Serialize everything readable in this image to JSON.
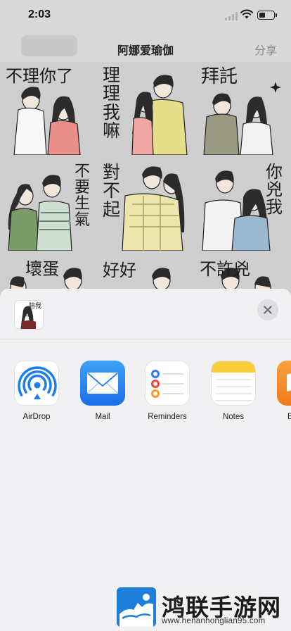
{
  "status_bar": {
    "time": "2:03"
  },
  "nav": {
    "title": "阿娜爱瑜伽",
    "share_label": "分享"
  },
  "stickers": [
    {
      "caption": "不理你了"
    },
    {
      "caption": "理理我嘛"
    },
    {
      "caption": "拜託"
    },
    {
      "caption": "不要生氣"
    },
    {
      "caption": "對不起"
    },
    {
      "caption": "你兇我"
    },
    {
      "caption": "壞蛋"
    },
    {
      "caption": "好好"
    },
    {
      "caption": "不許兇"
    }
  ],
  "sheet": {
    "thumbnail_caption": "陪我",
    "apps": [
      {
        "label": "AirDrop",
        "icon": "airdrop-icon"
      },
      {
        "label": "Mail",
        "icon": "mail-icon"
      },
      {
        "label": "Reminders",
        "icon": "reminders-icon"
      },
      {
        "label": "Notes",
        "icon": "notes-icon"
      },
      {
        "label": "B",
        "icon": "books-icon"
      }
    ]
  },
  "watermark": {
    "brand": "鸿联手游网",
    "url": "www.henanhonglian95.com"
  },
  "colors": {
    "accent_blue": "#1a7ef0",
    "sheet_bg": "#f1f1f3"
  }
}
